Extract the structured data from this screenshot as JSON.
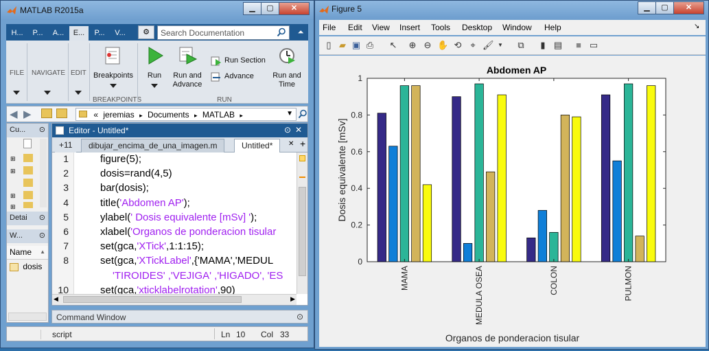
{
  "matlab": {
    "title": "MATLAB R2015a",
    "ribbon_tabs": [
      "H...",
      "P...",
      "A...",
      "E...",
      "P...",
      "V..."
    ],
    "search_placeholder": "Search Documentation",
    "toolstrip": {
      "file": "FILE",
      "navigate": "NAVIGATE",
      "edit": "EDIT",
      "breakpoints": "Breakpoints",
      "breakpoints_group": "BREAKPOINTS",
      "run": "Run",
      "run_and_advance_1": "Run and",
      "run_and_advance_2": "Advance",
      "run_section": "Run Section",
      "advance": "Advance",
      "run_and_time_1": "Run and",
      "run_and_time_2": "Time",
      "run_group": "RUN"
    },
    "address": {
      "prefix": "«",
      "path": [
        "jeremias",
        "Documents",
        "MATLAB"
      ],
      "sep": "▸"
    },
    "left_panels": {
      "current_folder": "Cu...",
      "details": "Detai",
      "workspace": "W...",
      "name_col": "Name",
      "var": "dosis",
      "sort_arrow": "▲"
    },
    "editor": {
      "header": "Editor - Untitled*",
      "overflow_tab": "+11",
      "tabs": [
        "dibujar_encima_de_una_imagen.m",
        "Untitled*"
      ],
      "lines": [
        {
          "num": "1",
          "pre": "figure(5);",
          "str": "",
          "post": ""
        },
        {
          "num": "2",
          "pre": "dosis=rand(4,5)",
          "str": "",
          "post": ""
        },
        {
          "num": "3",
          "pre": "bar(dosis);",
          "str": "",
          "post": ""
        },
        {
          "num": "4",
          "pre": "title(",
          "str": "'Abdomen AP'",
          "post": ");"
        },
        {
          "num": "5",
          "pre": "ylabel(",
          "str": "' Dosis equivalente [mSv] '",
          "post": ");"
        },
        {
          "num": "6",
          "pre": "xlabel(",
          "str": "'Organos de ponderacion tisular",
          "post": ""
        },
        {
          "num": "7",
          "pre": "set(gca,",
          "str": "'XTick'",
          "post": ",1:1:15);"
        },
        {
          "num": "8",
          "pre": "set(gca,",
          "str": "'XTickLabel'",
          "post": ",{'MAMA','MEDUL"
        },
        {
          "num": "",
          "pre": "",
          "str": "'TIROIDES' ,'VEJIGA' ,'HIGADO', 'ES",
          "post": ""
        },
        {
          "num": "10",
          "pre": "set(gca,",
          "str": "'xticklabelrotation'",
          "post": ",90)"
        }
      ]
    },
    "command_window": "Command Window",
    "status": {
      "mode": "script",
      "ln_label": "Ln",
      "ln": "10",
      "col_label": "Col",
      "col": "33"
    }
  },
  "figure": {
    "title": "Figure 5",
    "menu": [
      "File",
      "Edit",
      "View",
      "Insert",
      "Tools",
      "Desktop",
      "Window",
      "Help"
    ]
  },
  "colors": {
    "s1": "#352a87",
    "s2": "#0f7fd8",
    "s3": "#2bb598",
    "s4": "#d2b45a",
    "s5": "#f9fb0e",
    "titlebar": "#7fa9d6",
    "string": "#a020f0"
  },
  "chart_data": {
    "type": "bar",
    "title": "Abdomen AP",
    "xlabel": "Organos de ponderacion tisular",
    "ylabel": "Dosis equivalente [mSv]",
    "categories": [
      "MAMA",
      "MEDULA OSEA",
      "COLON",
      "PULMON"
    ],
    "ylim": [
      0,
      1
    ],
    "yticks": [
      0,
      0.2,
      0.4,
      0.6,
      0.8,
      1
    ],
    "ytick_labels": [
      "0",
      "0.2",
      "0.4",
      "0.6",
      "0.8",
      "1"
    ],
    "xticklabel_rotation": 90,
    "grid": false,
    "series": [
      {
        "values": [
          0.81,
          0.9,
          0.13,
          0.91
        ]
      },
      {
        "values": [
          0.63,
          0.1,
          0.28,
          0.55
        ]
      },
      {
        "values": [
          0.96,
          0.97,
          0.16,
          0.97
        ]
      },
      {
        "values": [
          0.96,
          0.49,
          0.8,
          0.14
        ]
      },
      {
        "values": [
          0.42,
          0.91,
          0.79,
          0.96
        ]
      }
    ]
  }
}
